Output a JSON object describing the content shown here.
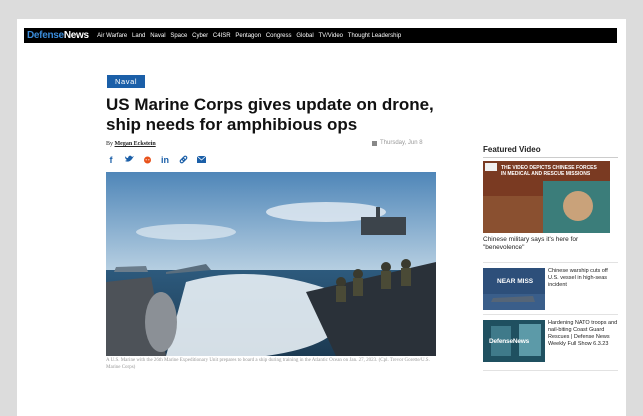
{
  "site": {
    "logo_part1": "Defense",
    "logo_part2": "News",
    "nav": [
      "Air Warfare",
      "Land",
      "Naval",
      "Space",
      "Cyber",
      "C4ISR",
      "Pentagon",
      "Congress",
      "Global",
      "TV/Video",
      "Thought Leadership"
    ]
  },
  "article": {
    "category": "Naval",
    "headline": "US Marine Corps gives update on drone, ship needs for amphibious ops",
    "by_prefix": "By",
    "author": "Megan Eckstein",
    "date": "Thursday, Jun 8",
    "share_icons": [
      "facebook-icon",
      "twitter-icon",
      "reddit-icon",
      "linkedin-icon",
      "link-icon",
      "email-icon"
    ],
    "caption": "A U.S. Marine with the 26th Marine Expeditionary Unit prepares to board a ship during training in the Atlantic Ocean on Jan. 27, 2023. (Cpl. Trevor Gorette/U.S. Marine Corps)"
  },
  "featured": {
    "title": "Featured Video",
    "main_video_title": "Chinese military says it's here for \"benevolence\"",
    "main_thumb_text": "THE VIDEO DEPICTS CHINESE FORCES IN MEDICAL AND RESCUE MISSIONS",
    "items": [
      {
        "title": "Chinese warship cuts off U.S. vessel in high-seas incident",
        "thumb_text": "NEAR MISS"
      },
      {
        "title": "Hardening NATO troops and nail-biting Coast Guard Rescues | Defense News Weekly Full Show 6.3.23",
        "thumb_text": "DefenseNews"
      }
    ]
  },
  "colors": {
    "accent": "#1b5fa8",
    "nav_bg": "#000000",
    "logo_blue": "#3a8bd8"
  }
}
